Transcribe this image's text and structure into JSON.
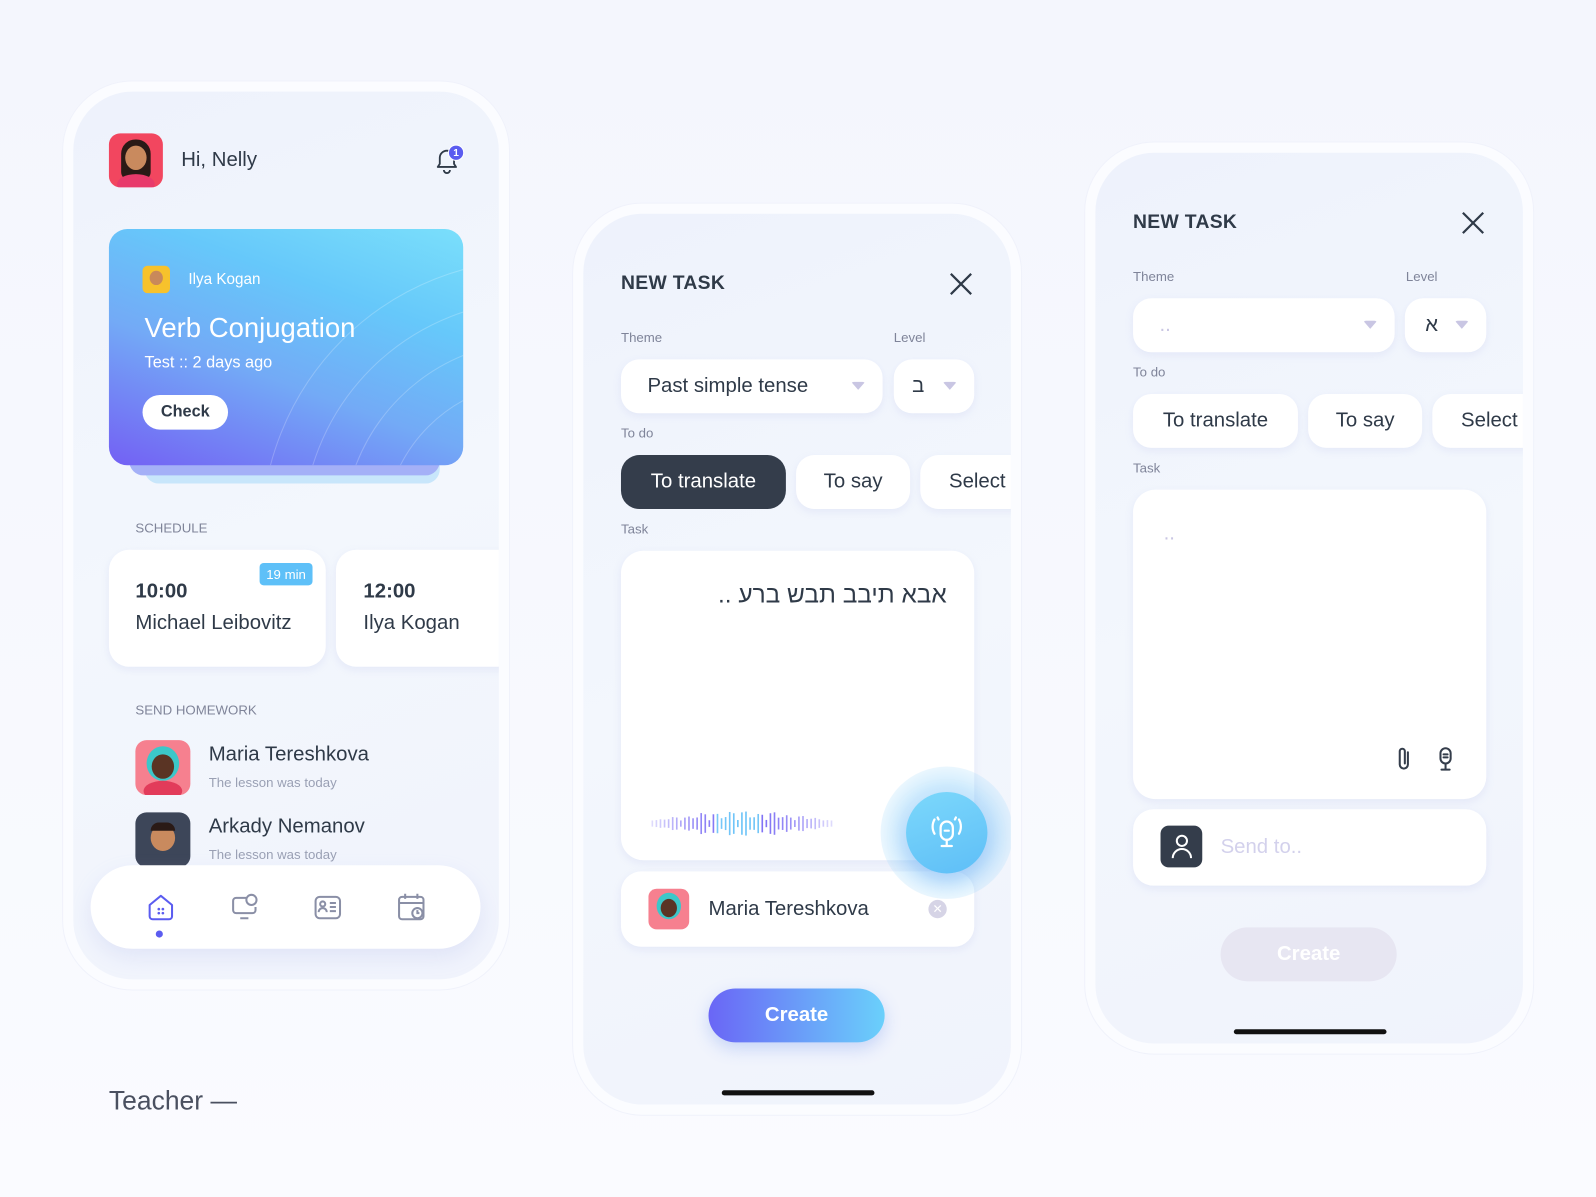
{
  "home": {
    "greeting": "Hi, Nelly",
    "notification_count": "1",
    "featured": {
      "teacher": "Ilya Kogan",
      "title": "Verb Conjugation",
      "subtitle": "Test :: 2 days ago",
      "button": "Check"
    },
    "schedule_label": "SCHEDULE",
    "schedule": [
      {
        "time": "10:00",
        "name": "Michael Leibovitz",
        "badge": "19 min"
      },
      {
        "time": "12:00",
        "name": "Ilya Kogan"
      }
    ],
    "homework_label": "SEND HOMEWORK",
    "homework": [
      {
        "name": "Maria Tereshkova",
        "sub": "The lesson was today"
      },
      {
        "name": "Arkady Nemanov",
        "sub": "The lesson was today"
      }
    ],
    "nav": [
      "home-icon",
      "chat-icon",
      "contacts-icon",
      "calendar-icon"
    ]
  },
  "task_filled": {
    "title": "NEW TASK",
    "theme_label": "Theme",
    "theme_value": "Past simple tense",
    "level_label": "Level",
    "level_value": "ב",
    "todo_label": "To do",
    "todo": [
      "To translate",
      "To say",
      "Select"
    ],
    "todo_selected": "To translate",
    "task_label": "Task",
    "task_text": "אבא תיבב תבש ברע ..",
    "recipient": "Maria Tereshkova",
    "create": "Create"
  },
  "task_empty": {
    "title": "NEW TASK",
    "theme_label": "Theme",
    "theme_placeholder": "..",
    "level_label": "Level",
    "level_value": "א",
    "todo_label": "To do",
    "todo": [
      "To translate",
      "To say",
      "Select"
    ],
    "task_label": "Task",
    "task_placeholder": "..",
    "send_to_placeholder": "Send to..",
    "create": "Create"
  },
  "caption": "Teacher —",
  "colors": {
    "dark": "#343d4b",
    "accent": "#5b5cf0",
    "badge": "#5ec0f8",
    "avatar_red": "#f2465f"
  }
}
